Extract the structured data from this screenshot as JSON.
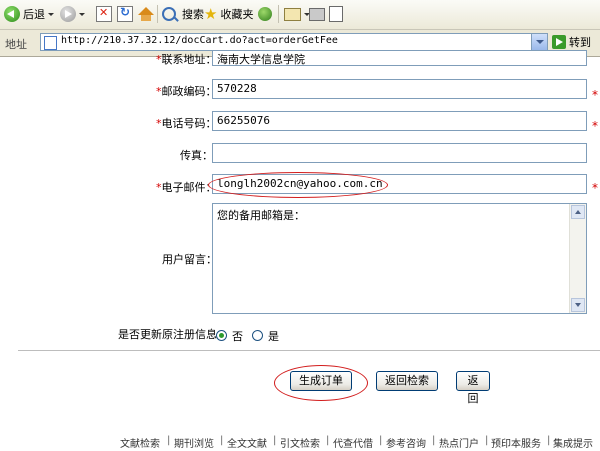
{
  "toolbar": {
    "back_label": "后退",
    "search_label": "搜索",
    "favorites_label": "收藏夹"
  },
  "address": {
    "label": "地址",
    "url": "http://210.37.32.12/docCart.do?act=orderGetFee",
    "go_label": "转到"
  },
  "form": {
    "address_label": "联系地址：",
    "address_value": "海南大学信息学院",
    "postal_label": "邮政编码：",
    "postal_value": "570228",
    "phone_label": "电话号码：",
    "phone_value": "66255076",
    "fax_label": "传真：",
    "fax_value": "",
    "email_label": "电子邮件：",
    "email_value": "longlh2002cn@yahoo.com.cn",
    "message_label": "用户留言：",
    "message_value": "您的备用邮箱是：",
    "update_label": "是否更新原注册信息：",
    "option_no": "否",
    "option_yes": "是",
    "required_mark": "*"
  },
  "buttons": {
    "generate_order": "生成订单",
    "back_search": "返回检索",
    "back": "返回"
  },
  "footer": {
    "links": [
      "文献检索",
      "期刊浏览",
      "全文文献",
      "引文检索",
      "代查代借",
      "参考咨询",
      "热点门户",
      "预印本服务",
      "集成提示"
    ],
    "separator": "|"
  },
  "colors": {
    "required": "#d40000",
    "annotation": "#d21d1d",
    "input_border": "#7f9db9"
  }
}
